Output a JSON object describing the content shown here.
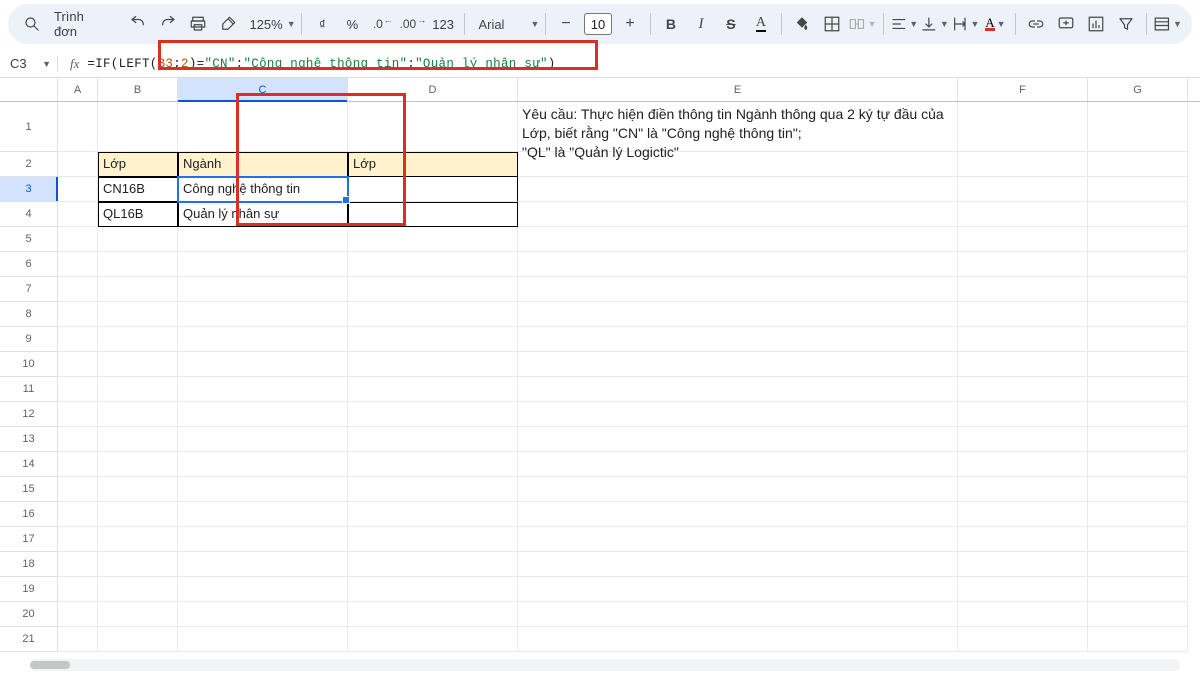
{
  "toolbar": {
    "menus_label": "Trình đơn",
    "zoom": "125%",
    "currency_sym": "₫",
    "percent": "%",
    "dec_dec": ".0",
    "inc_dec": ".00",
    "fmt_123": "123",
    "font_name": "Arial",
    "font_size": "10",
    "bold": "B",
    "italic": "I",
    "strike": "S",
    "text_a": "A",
    "color_a": "A"
  },
  "namebox": "C3",
  "formula": {
    "raw": "=IF(LEFT(B3;2)=\"CN\";\"Công nghệ thông tin\";\"Quản lý nhân sự\")",
    "p1": "=IF(LEFT(",
    "p2": "B3",
    "p3": ";",
    "p4": "2",
    "p5": ")=",
    "p6": "\"CN\"",
    "p7": ";",
    "p8": "\"Công nghệ thông tin\"",
    "p9": ";",
    "p10": "\"Quản lý nhân sự\"",
    "p11": ")"
  },
  "columns": [
    "A",
    "B",
    "C",
    "D",
    "E",
    "F",
    "G"
  ],
  "rows": [
    "1",
    "2",
    "3",
    "4",
    "5",
    "6",
    "7",
    "8",
    "9",
    "10",
    "11",
    "12",
    "13",
    "14",
    "15",
    "16",
    "17",
    "18",
    "19",
    "20",
    "21"
  ],
  "cells": {
    "E1": "Yêu cầu: Thực hiện điền thông tin Ngành thông qua 2 ký tự đầu của Lớp, biết rằng \"CN\" là \"Công nghệ thông tin\";\n\"QL\" là \"Quản lý Logictic\"",
    "B2": "Lớp",
    "C2": "Ngành",
    "D2": "Lớp",
    "B3": "CN16B",
    "C3": "Công nghệ thông tin",
    "B4": "QL16B",
    "C4": "Quản lý nhân sự"
  }
}
